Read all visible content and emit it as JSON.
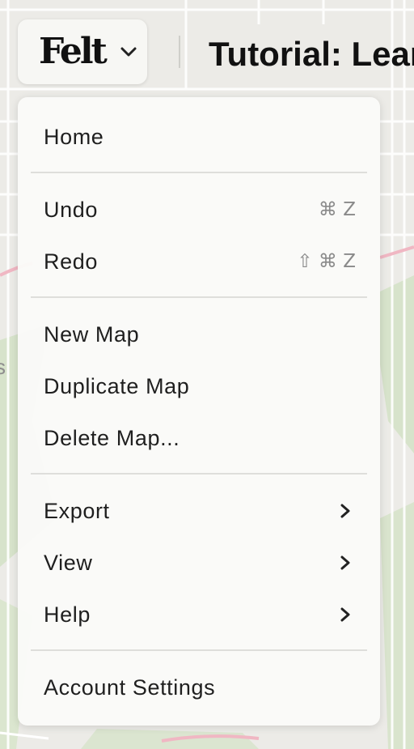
{
  "app": {
    "logo_text": "Felt",
    "map_title": "Tutorial: Lear"
  },
  "menu": {
    "home": "Home",
    "undo": {
      "label": "Undo",
      "shortcut": "⌘ Z"
    },
    "redo": {
      "label": "Redo",
      "shortcut": "⇧ ⌘ Z"
    },
    "new_map": "New Map",
    "duplicate_map": "Duplicate Map",
    "delete_map": "Delete Map...",
    "export": "Export",
    "view": "View",
    "help": "Help",
    "account_settings": "Account Settings"
  },
  "icons": {
    "logo_dropdown": "chevron-down-icon",
    "submenu": "chevron-right-icon"
  },
  "colors": {
    "map_land": "#ecebe7",
    "map_green": "#d7e3cb",
    "road_pink": "#f0b7c3",
    "menu_bg": "#fafaf8"
  }
}
